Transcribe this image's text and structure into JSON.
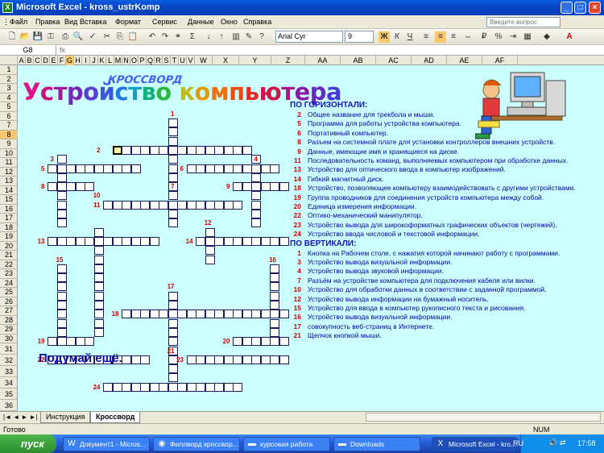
{
  "window": {
    "title": "Microsoft Excel - kross_ustrKomp",
    "app_icon": "X"
  },
  "menu": {
    "items": [
      "Файл",
      "Правка",
      "Вид",
      "Вставка",
      "Формат",
      "Сервис",
      "Данные",
      "Окно",
      "Справка"
    ],
    "help_placeholder": "Введите вопрос"
  },
  "toolbar": {
    "font_name": "Arial Cyr",
    "font_size": "9"
  },
  "formula": {
    "cell_ref": "G8",
    "fx": "fx",
    "content": ""
  },
  "columns": [
    "A",
    "B",
    "C",
    "D",
    "E",
    "F",
    "G",
    "H",
    "I",
    "J",
    "K",
    "L",
    "M",
    "N",
    "O",
    "P",
    "Q",
    "R",
    "S",
    "T",
    "U",
    "V",
    "W",
    "X",
    "Y",
    "Z",
    "AA",
    "AB",
    "AC",
    "AD",
    "AE",
    "AF"
  ],
  "rows": [
    "1",
    "2",
    "3",
    "4",
    "5",
    "6",
    "7",
    "8",
    "9",
    "10",
    "11",
    "12",
    "13",
    "14",
    "15",
    "16",
    "17",
    "18",
    "19",
    "20",
    "21",
    "22",
    "23",
    "24",
    "25",
    "26",
    "27",
    "28",
    "29",
    "30",
    "31",
    "32",
    "33",
    "34",
    "35",
    "36"
  ],
  "sheet": {
    "wordart_small": "КРОССВОРД",
    "wordart_big": "Устройство компьютера",
    "think_more": "Подумай ещё."
  },
  "clues": {
    "across_title": "ПО ГОРИЗОНТАЛИ:",
    "across": [
      {
        "n": "2",
        "text": "Общее название для трекбола и мыши."
      },
      {
        "n": "5",
        "text": "Программа для работы устройства компьютера."
      },
      {
        "n": "6",
        "text": "Портативный компьютер."
      },
      {
        "n": "8",
        "text": "Разъем на системной плате для установки контроллеров внешних устройств."
      },
      {
        "n": "9",
        "text": "Данные, имеющие имя и хранящиеся на диске."
      },
      {
        "n": "11",
        "text": "Последовательность команд, выполняемых компьютером при обработке данных."
      },
      {
        "n": "13",
        "text": "Устройство для оптического ввода в компьютер изображений."
      },
      {
        "n": "14",
        "text": "Гибкий магнитный диск."
      },
      {
        "n": "18",
        "text": "Устройство, позволяющее компьютеру взаимодействовать с другими устройствами."
      },
      {
        "n": "19",
        "text": "Группа проводников для соединения устройств компьютера между собой."
      },
      {
        "n": "20",
        "text": "Единица измерения информации."
      },
      {
        "n": "22",
        "text": "Оптико-механический манипулятор."
      },
      {
        "n": "23",
        "text": "Устройство вывода для широкоформатных графических объектов (чертежей)."
      },
      {
        "n": "24",
        "text": "Устройство ввода числовой и текстовой информации."
      }
    ],
    "down_title": "ПО ВЕРТИКАЛИ:",
    "down": [
      {
        "n": "1",
        "text": "Кнопка на Рабочем столе, с нажатия которой начинают работу с программами."
      },
      {
        "n": "3",
        "text": "Устройство вывода визуальной информации."
      },
      {
        "n": "4",
        "text": "Устройство вывода звуковой информации."
      },
      {
        "n": "7",
        "text": "Разъём на устройстве компьютера для подключения кабеля или вилки."
      },
      {
        "n": "10",
        "text": "Устройство для обработки данных в соответствии с заданной программой."
      },
      {
        "n": "12",
        "text": "Устройство вывода информации на бумажный носитель."
      },
      {
        "n": "15",
        "text": "Устройство для ввода в компьютер рукописного текста и рисования."
      },
      {
        "n": "16",
        "text": "Устройство вывода визуальной информации."
      },
      {
        "n": "17",
        "text": "совокупность веб-страниц в Интернете."
      },
      {
        "n": "21",
        "text": "Щелчок кнопкой мыши."
      }
    ]
  },
  "grid_numbers": [
    "1",
    "2",
    "3",
    "4",
    "5",
    "6",
    "7",
    "8",
    "9",
    "10",
    "11",
    "12",
    "13",
    "14",
    "15",
    "16",
    "17",
    "18",
    "19",
    "20",
    "21",
    "22",
    "23",
    "24"
  ],
  "tabs": {
    "nav": "|◄ ◄ ► ►|",
    "items": [
      "Инструкция",
      "Кроссворд"
    ],
    "active": 1
  },
  "status": {
    "left": "Готово",
    "num": "NUM"
  },
  "taskbar": {
    "start": "пуск",
    "tasks": [
      "Документ1 - Micros...",
      "Филлворд кроссвор...",
      "курсовая работа",
      "Downloads",
      "Microsoft Excel - kro..."
    ],
    "lang": "RU",
    "clock": "17:58"
  },
  "colors": {
    "sheet_bg": "#CCFFFF",
    "clue_text": "#0000a0",
    "number_red": "#d10000",
    "selected_header": "#F9C86E"
  }
}
